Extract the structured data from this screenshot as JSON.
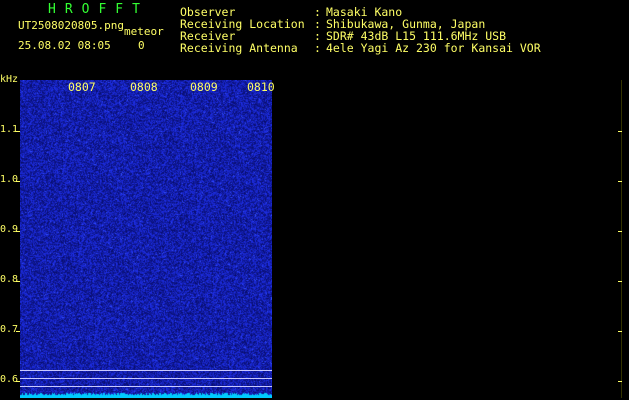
{
  "header": {
    "title": "HROFFT",
    "filename": "UT2508020805.png",
    "meteor_label": "meteor",
    "datetime": "25.08.02 08:05",
    "count": "0"
  },
  "info": [
    {
      "label": "Observer",
      "sep": ":",
      "value": "Masaki Kano"
    },
    {
      "label": "Receiving Location",
      "sep": ":",
      "value": "Shibukawa, Gunma, Japan"
    },
    {
      "label": "Receiver",
      "sep": ":",
      "value": "SDR# 43dB L15 111.6MHz USB"
    },
    {
      "label": "Receiving Antenna",
      "sep": ":",
      "value": "4ele Yagi Az 230 for Kansai VOR"
    }
  ],
  "axis": {
    "unit": "kHz",
    "y_labels": [
      "1.1",
      "1.0",
      "0.9",
      "0.8",
      "0.7",
      "0.6"
    ],
    "time_labels": [
      "0807",
      "0808",
      "0809",
      "0810"
    ]
  },
  "colors": {
    "background": "#000000",
    "text": "#ffff66",
    "title": "#33ff33",
    "waterfall_base": "#0a0a6a",
    "noise": "#2a3cff",
    "baseline": "#00ccff"
  }
}
